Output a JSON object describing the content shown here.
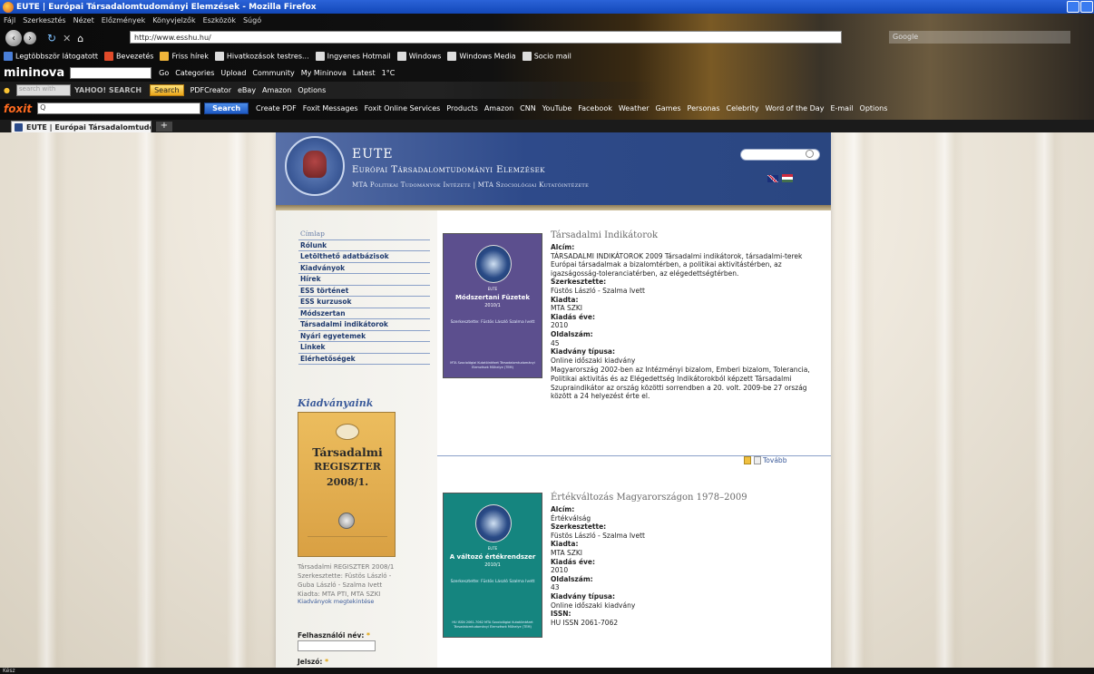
{
  "window": {
    "title": "EUTE | Európai Társadalomtudományi Elemzések - Mozilla Firefox"
  },
  "menubar": [
    "Fájl",
    "Szerkesztés",
    "Nézet",
    "Előzmények",
    "Könyvjelzők",
    "Eszközök",
    "Súgó"
  ],
  "navbar": {
    "url": "http://www.esshu.hu/",
    "search_placeholder": "Google"
  },
  "bookmarks": [
    "Legtöbbször látogatott",
    "Bevezetés",
    "Friss hírek",
    "Hivatkozások testres...",
    "Ingyenes Hotmail",
    "Windows",
    "Windows Media",
    "Socio mail"
  ],
  "mininova": {
    "logo": "mininova",
    "items": [
      "Go",
      "Categories",
      "Upload",
      "Community",
      "My Mininova",
      "Latest",
      "1°C"
    ]
  },
  "yahoo": {
    "input_placeholder": "search with",
    "brand": "YAHOO! SEARCH",
    "search_btn": "Search",
    "items": [
      "PDFCreator",
      "eBay",
      "Amazon",
      "Options"
    ]
  },
  "foxit": {
    "logo": "foxit",
    "input_value": "Q",
    "search_btn": "Search",
    "items": [
      "Create PDF",
      "Foxit Messages",
      "Foxit Online Services",
      "Products",
      "Amazon",
      "CNN",
      "YouTube",
      "Facebook",
      "Weather",
      "Games",
      "Personas",
      "Celebrity",
      "Word of the Day",
      "E-mail",
      "Options"
    ]
  },
  "tabs": {
    "active": "EUTE | Európai Társadalomtudomán...",
    "new_tab": "+"
  },
  "site": {
    "title": "EUTE",
    "subtitle": "Európai Társadalomtudományi Elemzések",
    "institutes": "MTA Politikai Tudományok Intézete | MTA Szociológiai Kutatóintézete",
    "menu": [
      "Címlap",
      "Rólunk",
      "Letölthető adatbázisok",
      "Kiadványok",
      "Hírek",
      "ESS történet",
      "ESS kurzusok",
      "Módszertan",
      "Társadalmi indikátorok",
      "Nyári egyetemek",
      "Linkek",
      "Elérhetőségek"
    ],
    "publications_title": "Kiadványaink",
    "pub_cover": {
      "line1": "Társadalmi",
      "line2": "REGISZTER",
      "line3": "2008/1."
    },
    "pub_caption": [
      "Társadalmi REGISZTER 2008/1",
      "Szerkesztette: Füstös László -",
      "Guba László - Szalma Ivett",
      "Kiadta: MTA PTI, MTA SZKI"
    ],
    "pub_link": "Kiadványok megtekintése",
    "login": {
      "username_label": "Felhasználói név:",
      "password_label": "Jelszó:",
      "required": "*"
    }
  },
  "entries": [
    {
      "title": "Társadalmi Indikátorok",
      "cover_color": "#5c4f8e",
      "cover": {
        "eute": "EUTE",
        "title": "Módszertani Füzetek",
        "sub": "2010/1",
        "editors": "Szerkesztette: Füstös László Szalma Ivett",
        "footer": "MTA Szociológiai Kutatóintézet Társadalomtudományi Elemzések Műhelye (TEM)"
      },
      "alcim_label": "Alcím:",
      "alcim": "TÁRSADALMI INDIKÁTOROK 2009 Társadalmi indikátorok, társadalmi-terek Európai társadalmak a bizalomtérben, a politikai aktivitástérben, az igazságosság-toleranciatérben, az elégedettségtérben.",
      "editor_label": "Szerkesztette:",
      "editor": "Füstös László - Szalma Ivett",
      "publisher_label": "Kiadta:",
      "publisher": "MTA SZKI",
      "year_label": "Kiadás éve:",
      "year": "2010",
      "pages_label": "Oldalszám:",
      "pages": "45",
      "type_label": "Kiadvány típusa:",
      "type": "Online időszaki kiadvány",
      "desc": "Magyarország 2002-ben az Intézményi bizalom, Emberi bizalom, Tolerancia, Politikai aktivitás és az Elégedettség Indikátorokból képzett Társadalmi Szupraindikátor az ország közötti sorrendben a 20. volt. 2009-be 27 ország között a 24 helyezést érte el.",
      "more": "Tovább"
    },
    {
      "title": "Értékváltozás Magyarországon 1978–2009",
      "cover_color": "#15857f",
      "cover": {
        "eute": "EUTE",
        "title": "A változó értékrendszer",
        "sub": "2010/1",
        "editors": "Szerkesztette: Füstös László Szalma Ivett",
        "footer": "HU ISSN 2061-7062 MTA Szociológiai Kutatóintézet Társadalomtudományi Elemzések Műhelye (TEM)"
      },
      "alcim_label": "Alcím:",
      "alcim": "Értékválság",
      "editor_label": "Szerkesztette:",
      "editor": "Füstös László - Szalma Ivett",
      "publisher_label": "Kiadta:",
      "publisher": "MTA SZKI",
      "year_label": "Kiadás éve:",
      "year": "2010",
      "pages_label": "Oldalszám:",
      "pages": "43",
      "type_label": "Kiadvány típusa:",
      "type": "Online időszaki kiadvány",
      "issn_label": "ISSN:",
      "issn": "HU ISSN 2061-7062"
    }
  ],
  "statusbar": "Kész"
}
